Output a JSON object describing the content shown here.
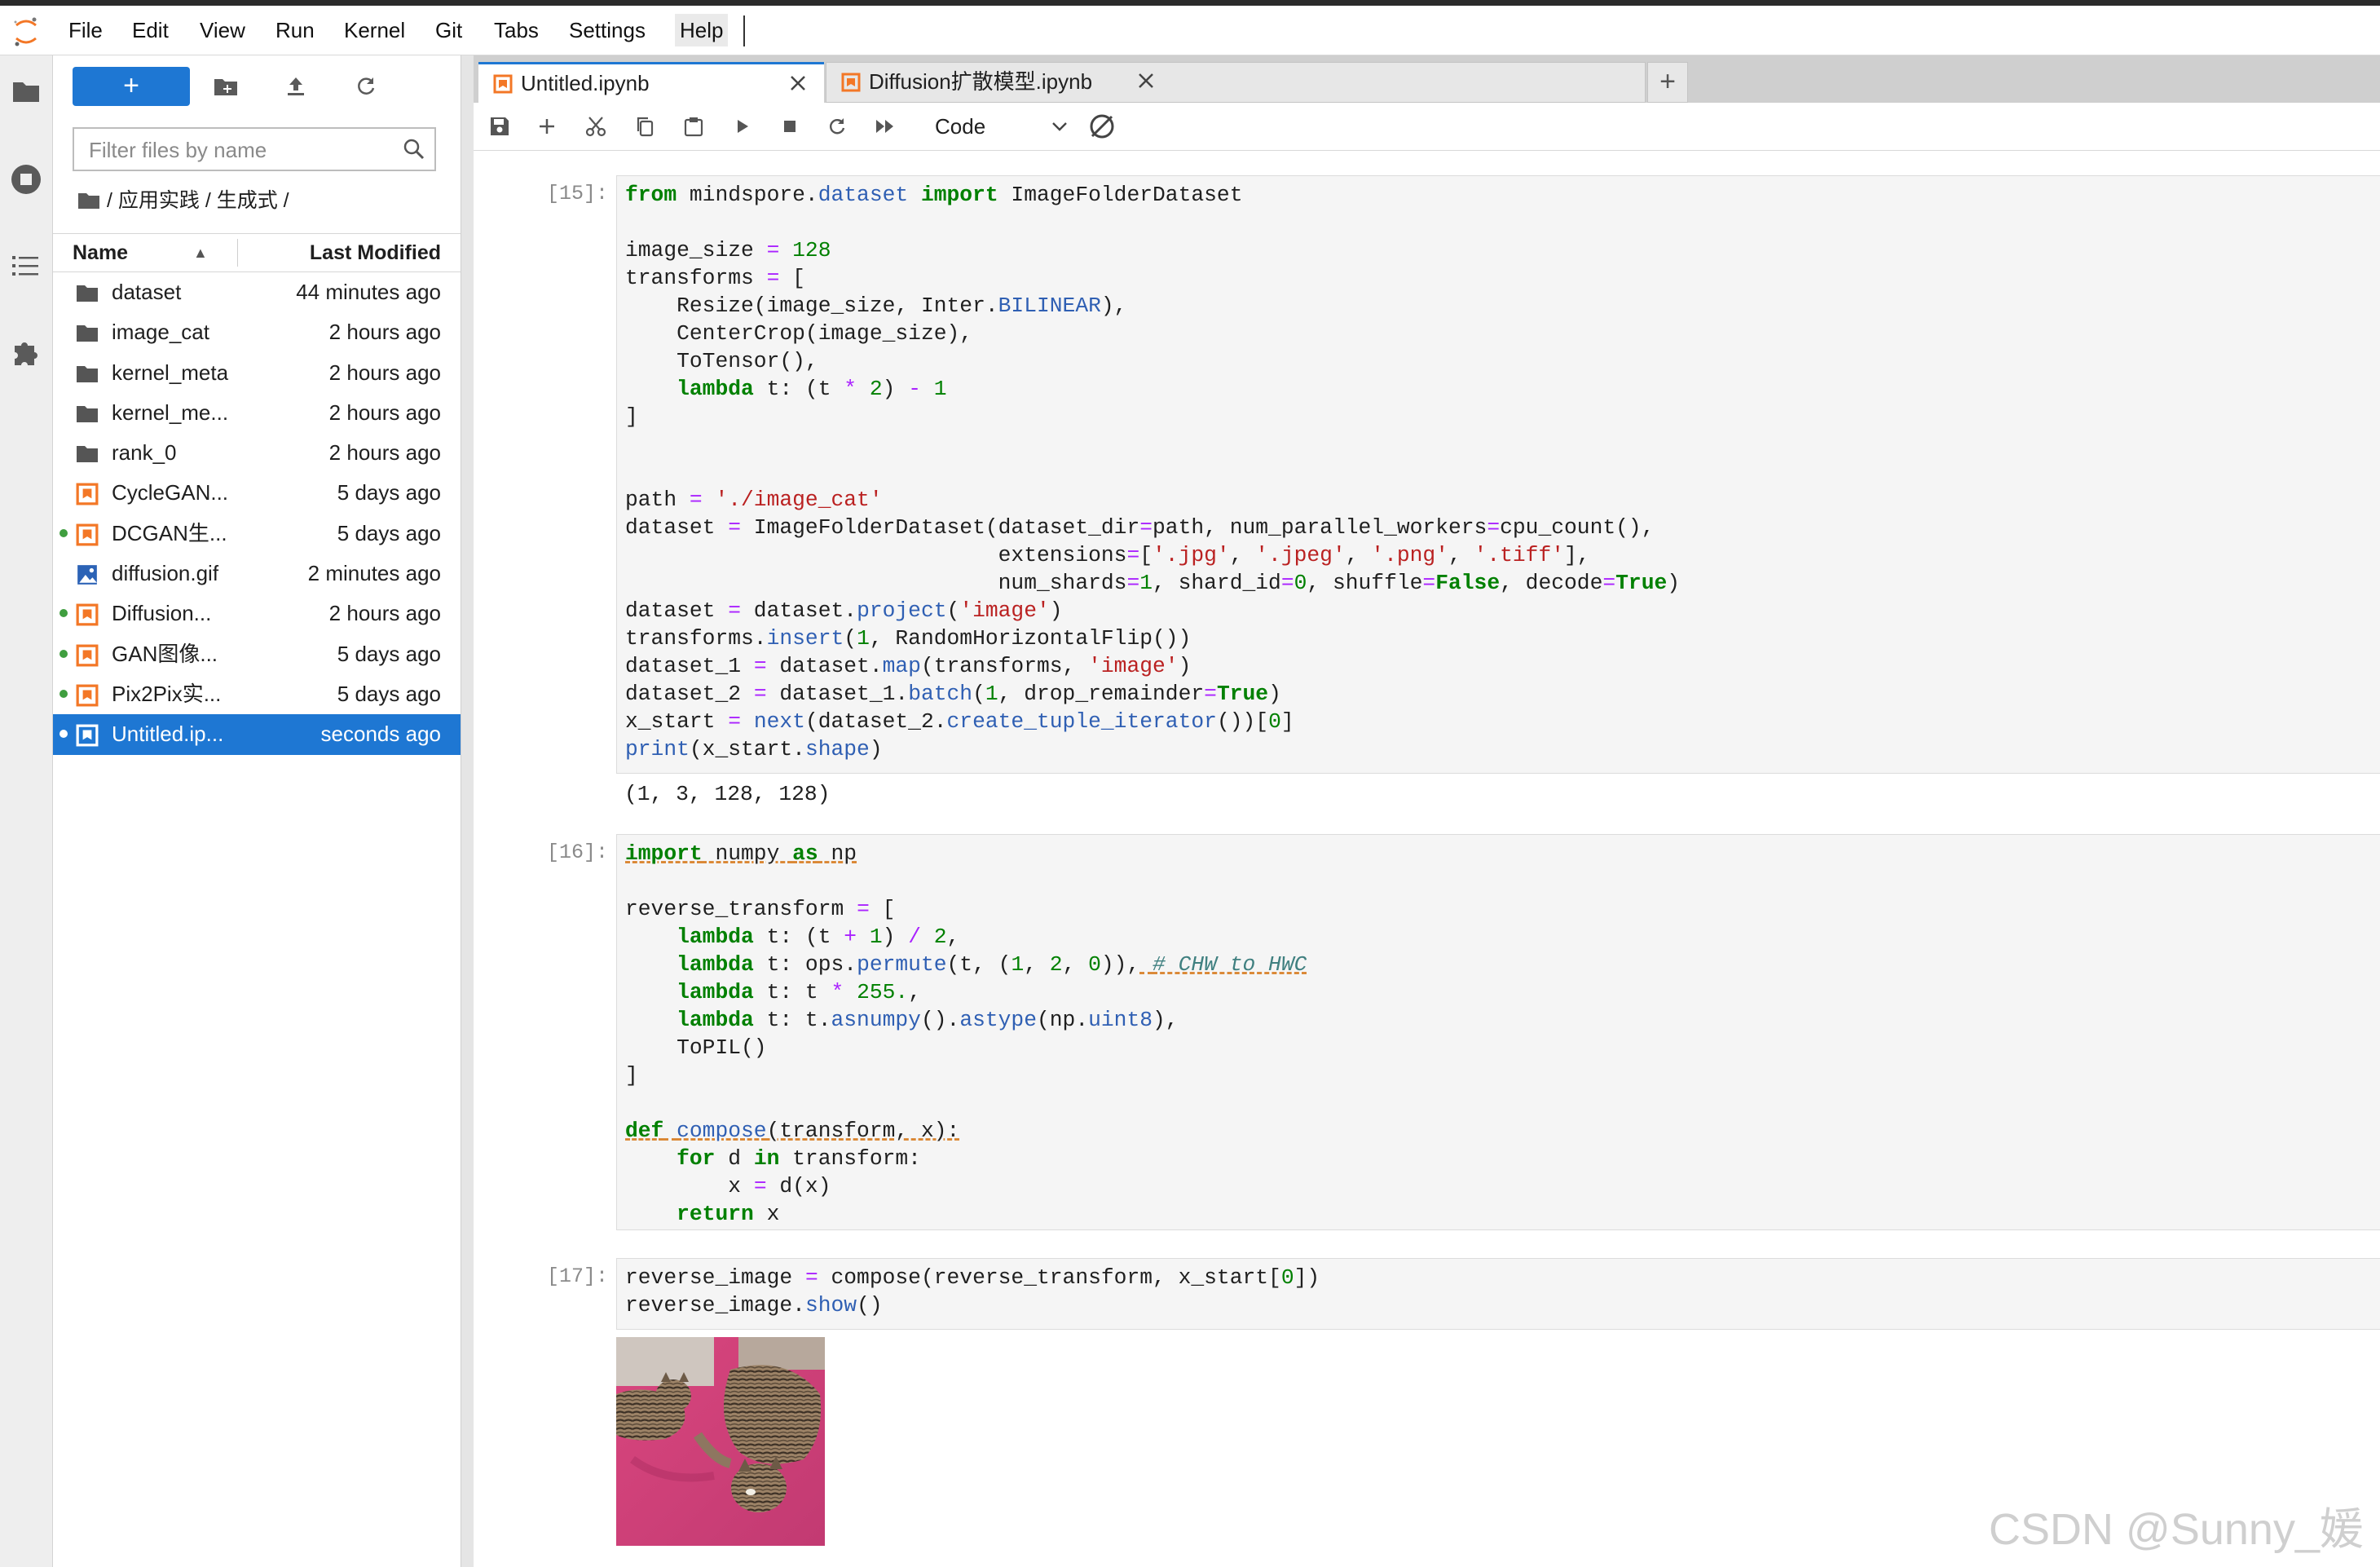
{
  "menu": [
    "File",
    "Edit",
    "View",
    "Run",
    "Kernel",
    "Git",
    "Tabs",
    "Settings",
    "Help"
  ],
  "filebrowser": {
    "new_label": "+",
    "filter_placeholder": "Filter files by name",
    "breadcrumb": "/ 应用实践 / 生成式 /",
    "col_name": "Name",
    "col_modified": "Last Modified",
    "sort_indicator": "▲",
    "files": [
      {
        "name": "dataset",
        "modified": "44 minutes ago",
        "type": "folder",
        "running": false
      },
      {
        "name": "image_cat",
        "modified": "2 hours ago",
        "type": "folder",
        "running": false
      },
      {
        "name": "kernel_meta",
        "modified": "2 hours ago",
        "type": "folder",
        "running": false
      },
      {
        "name": "kernel_me...",
        "modified": "2 hours ago",
        "type": "folder",
        "running": false
      },
      {
        "name": "rank_0",
        "modified": "2 hours ago",
        "type": "folder",
        "running": false
      },
      {
        "name": "CycleGAN...",
        "modified": "5 days ago",
        "type": "notebook",
        "running": false
      },
      {
        "name": "DCGAN生...",
        "modified": "5 days ago",
        "type": "notebook",
        "running": true
      },
      {
        "name": "diffusion.gif",
        "modified": "2 minutes ago",
        "type": "image",
        "running": false
      },
      {
        "name": "Diffusion...",
        "modified": "2 hours ago",
        "type": "notebook",
        "running": true
      },
      {
        "name": "GAN图像...",
        "modified": "5 days ago",
        "type": "notebook",
        "running": true
      },
      {
        "name": "Pix2Pix实...",
        "modified": "5 days ago",
        "type": "notebook",
        "running": true
      },
      {
        "name": "Untitled.ip...",
        "modified": "seconds ago",
        "type": "notebook",
        "running": true,
        "selected": true
      }
    ]
  },
  "tabs": [
    {
      "label": "Untitled.ipynb",
      "active": true
    },
    {
      "label": "Diffusion扩散模型.ipynb",
      "active": false
    }
  ],
  "tab_add": "+",
  "toolbar": {
    "cell_type": "Code"
  },
  "cells": [
    {
      "prompt": "[15]:",
      "output": "(1, 3, 128, 128)"
    },
    {
      "prompt": "[16]:"
    },
    {
      "prompt": "[17]:"
    }
  ],
  "watermark": "CSDN @Sunny_媛",
  "colors": {
    "accent": "#1e77d3",
    "notebook_icon": "#f37726",
    "running_dot": "#3f9e3f"
  }
}
